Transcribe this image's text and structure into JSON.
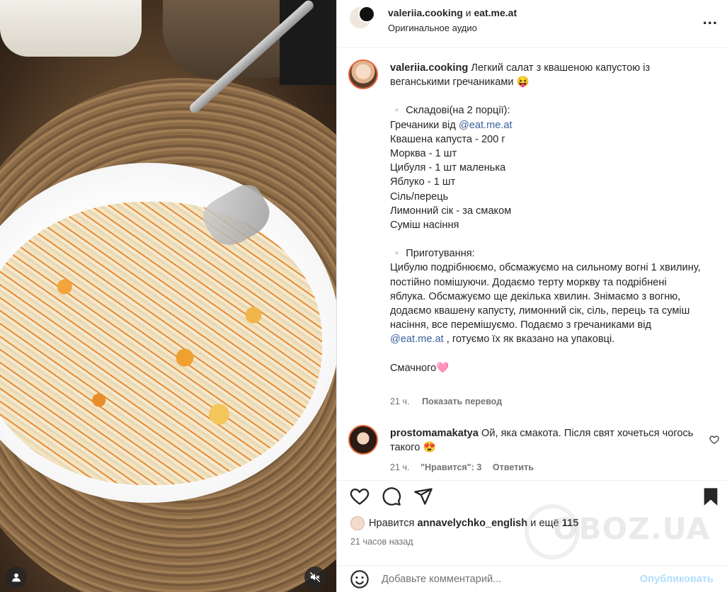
{
  "header": {
    "user1": "valeriia.cooking",
    "joiner": "и",
    "user2": "eat.me.at",
    "audio": "Оригинальное аудио",
    "more": "..."
  },
  "caption": {
    "username": "valeriia.cooking",
    "title": "Легкий салат з квашеною капустою із веганськими гречаниками 😝",
    "ingredients_heading": "▫️ Складові(на 2 порції):",
    "ingredient_1_prefix": "Гречаники від",
    "ingredient_1_mention": "@eat.me.at",
    "ingredients": [
      "Квашена капуста - 200 г",
      "Морква - 1 шт",
      "Цибуля - 1 шт маленька",
      "Яблуко - 1 шт",
      "Сіль/перець",
      "Лимонний сік - за смаком",
      "Суміш насіння"
    ],
    "method_heading": "▫️ Приготування:",
    "method_text_1": "Цибулю подрібнюємо, обсмажуємо на сильному вогні 1 хвилину, постійно помішуючи. Додаємо терту моркву та подрібнені яблука. Обсмажуємо ще декілька хвилин. Знімаємо з вогню, додаємо квашену капусту, лимонний сік, сіль, перець та суміш насіння, все перемішуємо. Подаємо з гречаниками від",
    "method_mention": "@eat.me.at",
    "method_text_2": ", готуємо їх як вказано на упаковці.",
    "closing": "Смачного🩷",
    "time": "21 ч.",
    "translate": "Показать перевод"
  },
  "comment": {
    "username": "prostomamakatya",
    "text": "Ой, яка смакота. Після свят хочеться чогось такого 😍",
    "time": "21 ч.",
    "likes": "\"Нравится\": 3",
    "reply": "Ответить"
  },
  "likes": {
    "prefix": "Нравится",
    "user": "annavelychko_english",
    "middle": "и ещё",
    "count": "115"
  },
  "posted": "21 часов назад",
  "compose": {
    "placeholder": "Добавьте комментарий...",
    "publish": "Опубликовать"
  },
  "watermark": "OBOZ.UA",
  "icons": {
    "like": "heart-icon",
    "comment": "comment-icon",
    "share": "share-icon",
    "save": "bookmark-icon",
    "emoji": "emoji-icon",
    "mute": "mute-icon",
    "user_tag": "user-tag-icon"
  }
}
